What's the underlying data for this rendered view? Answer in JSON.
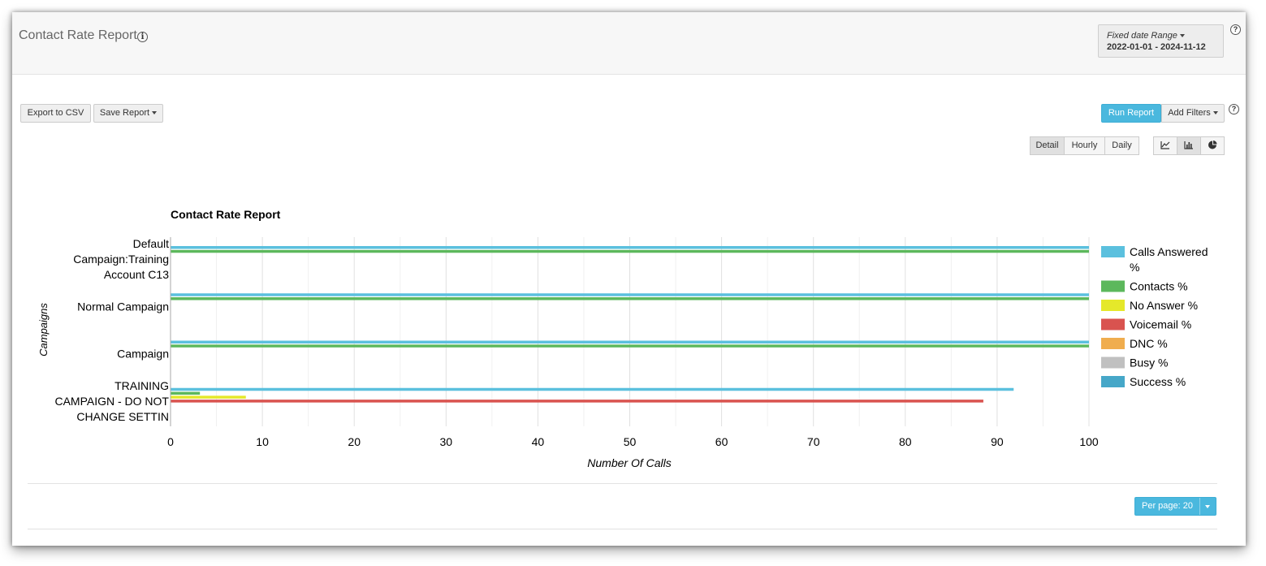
{
  "header": {
    "title": "Contact Rate Report",
    "info_icon": "info-icon",
    "date_range": {
      "label": "Fixed date Range",
      "value": "2022-01-01 - 2024-11-12"
    }
  },
  "toolbar": {
    "export_label": "Export to CSV",
    "save_label": "Save Report",
    "run_label": "Run Report",
    "filters_label": "Add Filters",
    "view_modes": [
      "Detail",
      "Hourly",
      "Daily"
    ],
    "active_view": "Detail",
    "chart_types": [
      "line-chart-icon",
      "bar-chart-icon",
      "pie-chart-icon"
    ],
    "active_chart": "bar-chart-icon"
  },
  "pagination": {
    "per_page_label": "Per page: 20"
  },
  "chart_data": {
    "type": "bar",
    "orientation": "horizontal",
    "title": "Contact Rate Report",
    "xlabel": "Number Of Calls",
    "ylabel": "Campaigns",
    "xlim": [
      0,
      100
    ],
    "xticks": [
      0,
      10,
      20,
      30,
      40,
      50,
      60,
      70,
      80,
      90,
      100
    ],
    "grid": true,
    "legend_position": "right",
    "categories": [
      [
        "Default",
        "Campaign:Training",
        "Account C13"
      ],
      [
        "Normal Campaign"
      ],
      [
        "Campaign"
      ],
      [
        "TRAINING",
        "CAMPAIGN - DO NOT",
        "CHANGE SETTIN"
      ]
    ],
    "series": [
      {
        "name": "Calls Answered %",
        "color": "#5bc0de",
        "values": [
          100,
          100,
          100,
          91.8
        ]
      },
      {
        "name": "Contacts %",
        "color": "#5cb85c",
        "values": [
          100,
          100,
          100,
          3.2
        ]
      },
      {
        "name": "No Answer %",
        "color": "#e5e82a",
        "values": [
          0,
          0,
          0,
          8.2
        ]
      },
      {
        "name": "Voicemail %",
        "color": "#d9534f",
        "values": [
          0,
          0,
          0,
          88.5
        ]
      },
      {
        "name": "DNC %",
        "color": "#f0ad4e",
        "values": [
          0,
          0,
          0,
          0
        ]
      },
      {
        "name": "Busy %",
        "color": "#c0c0c0",
        "values": [
          0,
          0,
          0,
          0
        ]
      },
      {
        "name": "Success %",
        "color": "#46a7c8",
        "values": [
          0,
          0,
          0,
          0
        ]
      }
    ]
  }
}
